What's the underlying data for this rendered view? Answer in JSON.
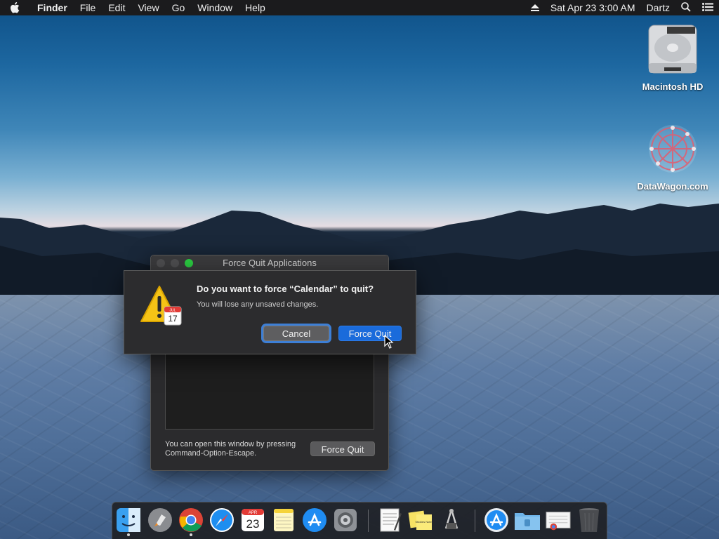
{
  "menubar": {
    "app_name": "Finder",
    "menus": [
      "File",
      "Edit",
      "View",
      "Go",
      "Window",
      "Help"
    ],
    "clock": "Sat Apr 23  3:00 AM",
    "user": "Dartz"
  },
  "desktop": {
    "icons": [
      {
        "label": "Macintosh HD",
        "icon": "hard-drive-icon"
      },
      {
        "label": "DataWagon.com",
        "icon": "datawagon-logo-icon"
      }
    ]
  },
  "force_quit_window": {
    "title": "Force Quit Applications",
    "hint": "You can open this window by pressing Command-Option-Escape.",
    "button": "Force Quit"
  },
  "alert": {
    "title": "Do you want to force “Calendar” to quit?",
    "message": "You will lose any unsaved changes.",
    "cancel_label": "Cancel",
    "force_quit_label": "Force Quit",
    "calendar_badge": {
      "month": "JUL",
      "day": "17"
    }
  },
  "dock": {
    "calendar_month": "APR",
    "calendar_day": "23",
    "stickies_text": "Stickies Notes"
  },
  "colors": {
    "accent": "#1a6bdb",
    "menubar_bg": "#1b1b1d",
    "dialog_bg": "#2c2c2e"
  }
}
